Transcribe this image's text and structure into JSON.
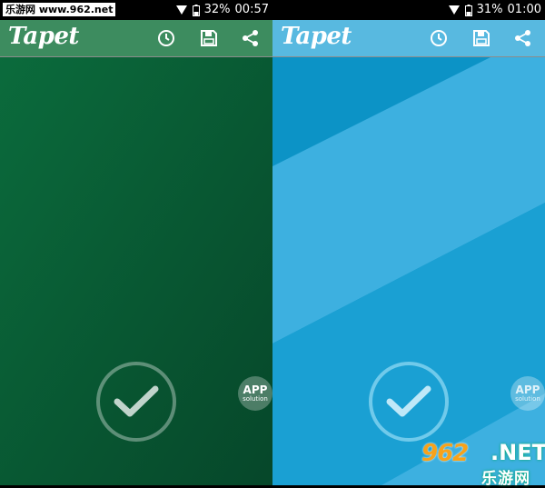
{
  "watermark_top": "乐游网 www.962.net",
  "left": {
    "status": {
      "battery": "32%",
      "time": "00:57"
    },
    "title": "Tapet",
    "icons": [
      "clock-icon",
      "save-icon",
      "share-icon"
    ],
    "colors": {
      "appbar": "#3d8c5f",
      "background": "#0b5a33"
    },
    "badge": {
      "line1": "APP",
      "line2": "solution"
    }
  },
  "right": {
    "status": {
      "battery": "31%",
      "time": "01:00"
    },
    "title": "Tapet",
    "icons": [
      "clock-icon",
      "save-icon",
      "share-icon"
    ],
    "colors": {
      "appbar": "#58b9e0",
      "background": "#0c93c6"
    },
    "badge": {
      "line1": "APP",
      "line2": "solution"
    }
  },
  "watermark_bottom": {
    "number": "962",
    "net": ".NET",
    "cn": "乐游网"
  }
}
